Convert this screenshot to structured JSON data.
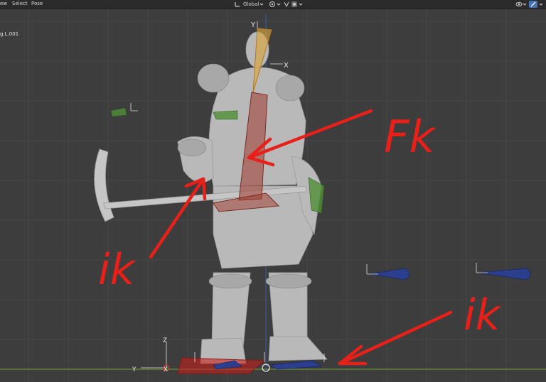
{
  "menu": {
    "view": "ew",
    "select": "Select",
    "pose": "Pose"
  },
  "header": {
    "orientation": "Global"
  },
  "object": {
    "name": "g.L.001"
  },
  "annotations": {
    "fk": "Fk",
    "ik_left": "ik",
    "ik_right": "ik"
  },
  "axes": {
    "y": "Y",
    "x": "X",
    "z": "Z"
  },
  "icons": [
    "transform-orientation-icon",
    "pivot-icon",
    "snap-icon",
    "proportional-edit-icon",
    "view-options-icon",
    "armature-display-icon",
    "chevron-down-icon"
  ],
  "colors": {
    "viewport_bg": "#3d3d3d",
    "grid": "#474747",
    "ground_line": "#6b8f3a",
    "z_axis": "#3a5fa8",
    "annotation_red": "#e8201a",
    "bone_orange": "#d9a43a",
    "ik_blue": "#2c3f8f",
    "fk_red": "#a0392e"
  }
}
